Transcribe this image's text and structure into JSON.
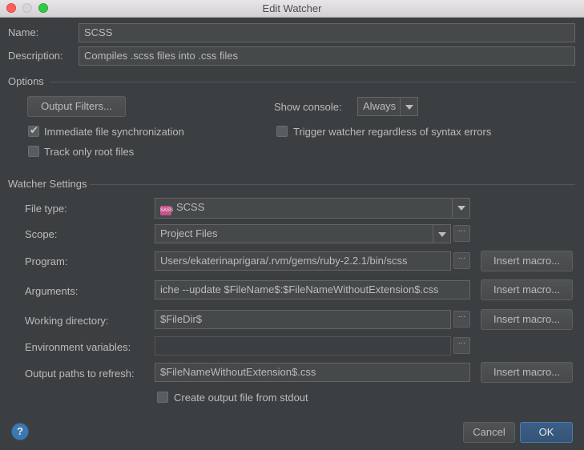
{
  "window": {
    "title": "Edit Watcher"
  },
  "name": {
    "label": "Name:",
    "value": "SCSS"
  },
  "description": {
    "label": "Description:",
    "value": "Compiles .scss files into .css files"
  },
  "options": {
    "section": "Options",
    "output_filters_button": "Output Filters...",
    "show_console_label": "Show console:",
    "show_console_value": "Always",
    "immediate_sync": {
      "label": "Immediate file synchronization",
      "checked": true
    },
    "track_root": {
      "label": "Track only root files",
      "checked": false
    },
    "trigger_regardless": {
      "label": "Trigger watcher regardless of syntax errors",
      "checked": false
    }
  },
  "watcher": {
    "section": "Watcher Settings",
    "file_type": {
      "label": "File type:",
      "value": "SCSS",
      "icon_text": "SASS"
    },
    "scope": {
      "label": "Scope:",
      "value": "Project Files"
    },
    "program": {
      "label": "Program:",
      "value": "Users/ekaterinaprigara/.rvm/gems/ruby-2.2.1/bin/scss"
    },
    "arguments": {
      "label": "Arguments:",
      "value": "iche --update $FileName$:$FileNameWithoutExtension$.css"
    },
    "working_dir": {
      "label": "Working directory:",
      "value": "$FileDir$"
    },
    "env_vars": {
      "label": "Environment variables:",
      "value": ""
    },
    "output_paths": {
      "label": "Output paths to refresh:",
      "value": "$FileNameWithoutExtension$.css"
    },
    "insert_macro": "Insert macro...",
    "create_output": {
      "label": "Create output file from stdout",
      "checked": false
    }
  },
  "footer": {
    "help": "?",
    "cancel": "Cancel",
    "ok": "OK"
  },
  "ellipsis": "···"
}
